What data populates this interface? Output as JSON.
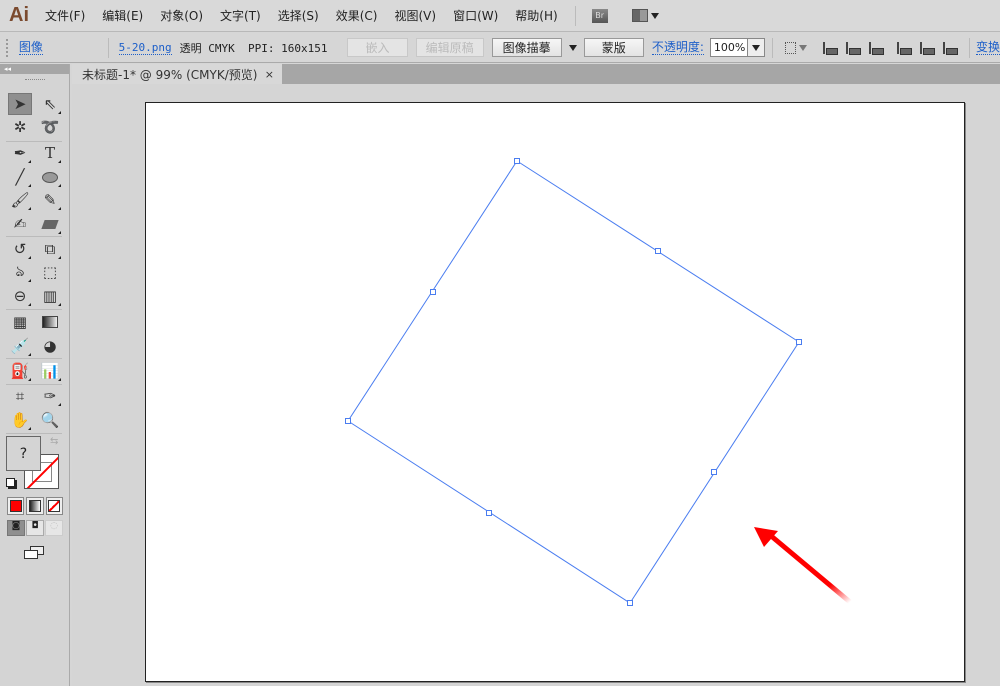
{
  "app": {
    "logo": "Ai"
  },
  "menu": [
    "文件(F)",
    "编辑(E)",
    "对象(O)",
    "文字(T)",
    "选择(S)",
    "效果(C)",
    "视图(V)",
    "窗口(W)",
    "帮助(H)"
  ],
  "menubar_icons": {
    "bridge": "Br"
  },
  "control": {
    "type_label": "图像",
    "filename": "5-20.png",
    "info": "透明 CMYK  PPI: 160x151",
    "embed": "嵌入",
    "edit_original": "编辑原稿",
    "image_trace": "图像描摹",
    "mask": "蒙版",
    "opacity_label": "不透明度:",
    "opacity_value": "100%",
    "transform": "变换"
  },
  "document_tab": {
    "title": "未标题-1* @ 99% (CMYK/预览)",
    "close": "×"
  },
  "tools": {
    "collapse": "◂◂",
    "fill_stroke_unknown": "?"
  },
  "colors": {
    "selection": "#4a7df0",
    "arrow": "#ff0000",
    "tab_active": "#d8d8d8"
  }
}
